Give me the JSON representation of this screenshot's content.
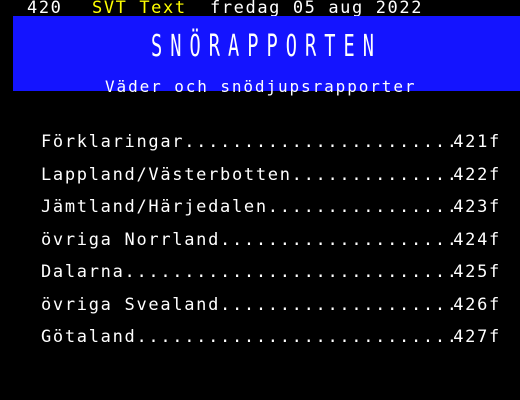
{
  "header": {
    "page_number": "420",
    "service": "SVT Text",
    "date": "fredag 05 aug 2022"
  },
  "banner": {
    "title": "SNÖRAPPORTEN",
    "subtitle": "Väder och snödjupsrapporter"
  },
  "menu": [
    {
      "label": "Förklaringar",
      "page": "421f"
    },
    {
      "label": "Lappland/Västerbotten",
      "page": "422f"
    },
    {
      "label": "Jämtland/Härjedalen",
      "page": "423f"
    },
    {
      "label": "övriga Norrland",
      "page": "424f"
    },
    {
      "label": "Dalarna",
      "page": "425f"
    },
    {
      "label": "övriga Svealand",
      "page": "426f"
    },
    {
      "label": "Götaland",
      "page": "427f"
    }
  ],
  "colors": {
    "background": "#000000",
    "banner": "#1414ff",
    "service_text": "#ffff00",
    "text": "#ffffff"
  }
}
